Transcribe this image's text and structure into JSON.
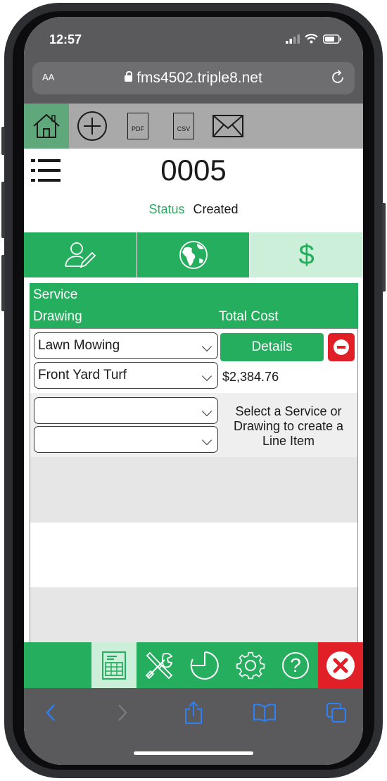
{
  "status_bar": {
    "time": "12:57"
  },
  "browser": {
    "text_size_label": "AA",
    "url": "fms4502.triple8.net"
  },
  "toolbar": {
    "icons": [
      "home-icon",
      "add-icon",
      "pdf-icon",
      "csv-icon",
      "mail-icon"
    ],
    "pdf_label": "PDF",
    "csv_label": "CSV"
  },
  "header": {
    "job_number": "0005",
    "status_label": "Status",
    "status_value": "Created"
  },
  "tabs": [
    {
      "icon": "customer-edit-icon",
      "active": false
    },
    {
      "icon": "globe-icon",
      "active": false
    },
    {
      "icon": "dollar-icon",
      "label": "$",
      "active": true
    }
  ],
  "line_items": {
    "headers": {
      "service": "Service",
      "drawing": "Drawing",
      "total_cost": "Total Cost"
    },
    "rows": [
      {
        "service": "Lawn Mowing",
        "drawing": "Front Yard Turf",
        "total_cost": "$2,384.76",
        "details_label": "Details"
      }
    ],
    "new_row_hint": [
      "Select a Service or",
      "Drawing to create a",
      "Line Item"
    ]
  },
  "bottom_bar": {
    "icons": [
      "spreadsheet-icon",
      "tools-icon",
      "history-icon",
      "gear-icon",
      "help-icon",
      "close-icon"
    ],
    "active": "spreadsheet-icon",
    "help_label": "?"
  },
  "colors": {
    "green": "#26ae5f",
    "light_green": "#ccefd9",
    "red": "#e01f26",
    "gray": "#a9a9a9"
  }
}
